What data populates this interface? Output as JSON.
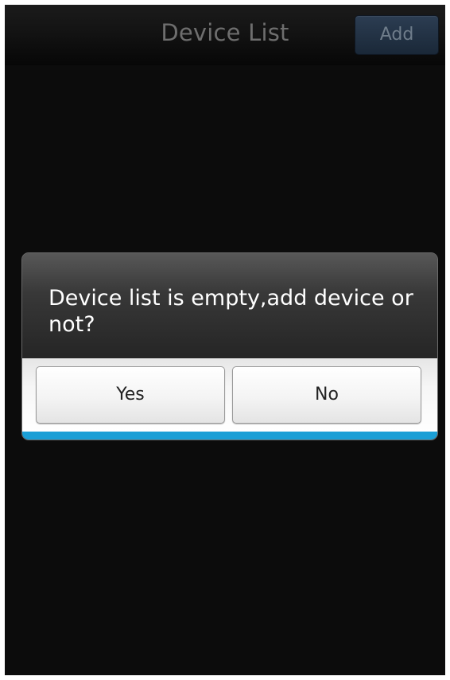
{
  "header": {
    "title": "Device List",
    "add_label": "Add"
  },
  "dialog": {
    "message": "Device list is empty,add device or not?",
    "yes_label": "Yes",
    "no_label": "No",
    "accent_color": "#1b9fd6"
  },
  "colors": {
    "background": "#0c0c0c",
    "add_button": "#223246"
  }
}
